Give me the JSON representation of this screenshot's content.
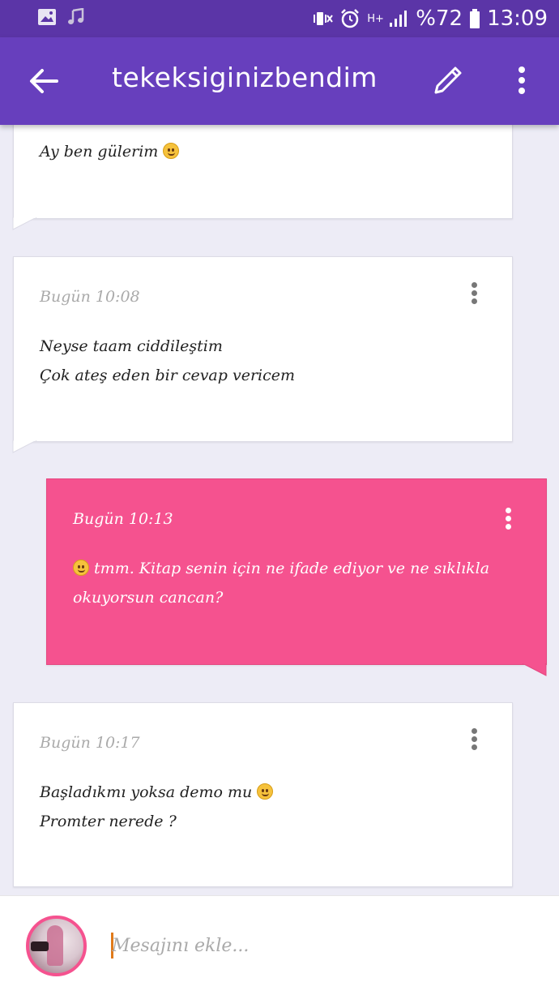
{
  "status_bar": {
    "battery": "%72",
    "time": "13:09",
    "network": "H+"
  },
  "app_bar": {
    "title": "tekeksiginizbendim"
  },
  "messages": [
    {
      "time": "",
      "lines": [
        "Ay ben gülerim"
      ],
      "emoji": "laughing-emoji"
    },
    {
      "time": "Bugün 10:08",
      "lines": [
        "Neyse taam ciddileştim",
        "Çok ateş eden bir cevap vericem"
      ]
    },
    {
      "time": "Bugün 10:13",
      "lines": [
        "tmm. Kitap senin için ne ifade ediyor ve ne sıklıkla",
        "okuyorsun cancan?"
      ],
      "mine": true
    },
    {
      "time": "Bugün 10:17",
      "lines": [
        "Başladıkmı yoksa demo mu",
        "Promter nerede ?"
      ]
    }
  ],
  "composer": {
    "placeholder": "Mesajını ekle..."
  },
  "colors": {
    "primary": "#673fbd",
    "status_bar": "#5b35a7",
    "my_bubble": "#f5528f",
    "background": "#edecf6"
  }
}
